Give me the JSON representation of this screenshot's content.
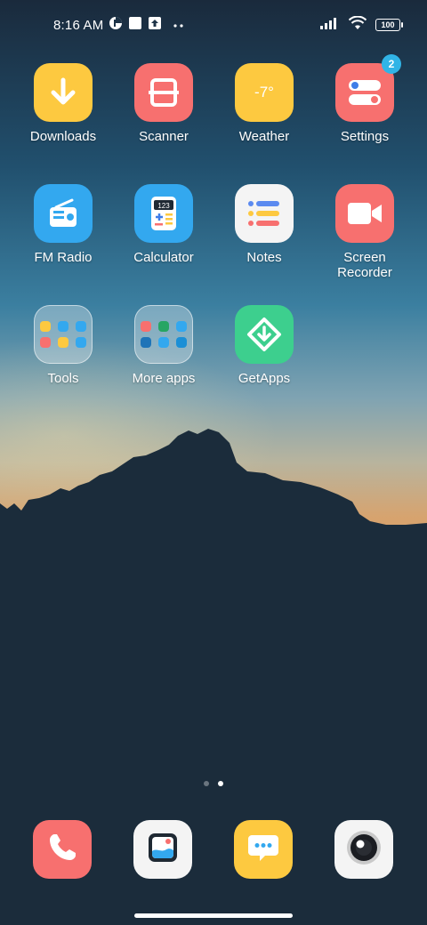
{
  "status_bar": {
    "time": "8:16 AM",
    "battery": "100",
    "icons": [
      "data-saver-icon",
      "square-notification-icon",
      "upload-icon",
      "more-dots-icon",
      "signal-icon",
      "wifi-icon",
      "battery-icon"
    ]
  },
  "apps": [
    {
      "label": "Downloads",
      "icon": "download-icon",
      "color": "#fdc940"
    },
    {
      "label": "Scanner",
      "icon": "scanner-icon",
      "color": "#f7706f"
    },
    {
      "label": "Weather",
      "icon": "weather-icon",
      "color": "#fdc940",
      "icon_text": "-7°"
    },
    {
      "label": "Settings",
      "icon": "settings-toggle-icon",
      "color": "#f7706f",
      "badge": "2"
    },
    {
      "label": "FM Radio",
      "icon": "radio-icon",
      "color": "#33a8ef"
    },
    {
      "label": "Calculator",
      "icon": "calculator-icon",
      "color": "#33a8ef",
      "icon_text": "123"
    },
    {
      "label": "Notes",
      "icon": "notes-icon",
      "color": "#f4f4f4"
    },
    {
      "label": "Screen Recorder",
      "label_line1": "Screen",
      "label_line2": "Recorder",
      "icon": "video-camera-icon",
      "color": "#f7706f"
    },
    {
      "label": "Tools",
      "icon": "folder-icon"
    },
    {
      "label": "More apps",
      "icon": "folder-icon"
    },
    {
      "label": "GetApps",
      "icon": "getapps-icon",
      "color": "#3dcf8e"
    }
  ],
  "page_indicator": {
    "pages": 2,
    "current": 2
  },
  "dock": [
    {
      "name": "phone",
      "icon": "phone-icon",
      "color": "#f7706f"
    },
    {
      "name": "gallery",
      "icon": "gallery-icon",
      "color": "#f4f4f4"
    },
    {
      "name": "messages",
      "icon": "messages-icon",
      "color": "#fdc940"
    },
    {
      "name": "camera",
      "icon": "camera-icon",
      "color": "#f4f4f4"
    }
  ]
}
